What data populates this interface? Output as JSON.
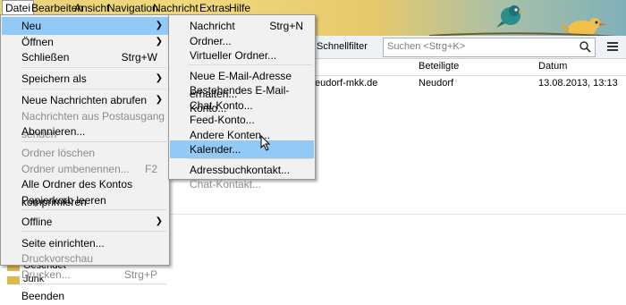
{
  "menubar": [
    "Datei",
    "Bearbeiten",
    "Ansicht",
    "Navigation",
    "Nachricht",
    "Extras",
    "Hilfe"
  ],
  "toolbar": {
    "quickfilter_label": "Schnellfilter",
    "search_placeholder": "Suchen <Strg+K>"
  },
  "list_header": {
    "col_beteiligte": "Beteiligte",
    "col_datum": "Datum"
  },
  "list_row": {
    "subject_fragment": "eudorf-mkk.de",
    "beteiligte": "Neudorf",
    "datum": "13.08.2013, 13:13"
  },
  "folders": [
    "Gesendet",
    "Junk"
  ],
  "file_menu": [
    {
      "label": "Neu",
      "submenu": true,
      "highlighted": true
    },
    {
      "label": "Öffnen",
      "submenu": true
    },
    {
      "label": "Schließen",
      "shortcut": "Strg+W"
    },
    {
      "sep": true
    },
    {
      "label": "Speichern als",
      "submenu": true
    },
    {
      "sep": true
    },
    {
      "label": "Neue Nachrichten abrufen",
      "submenu": true
    },
    {
      "label": "Nachrichten aus Postausgang senden",
      "disabled": true
    },
    {
      "label": "Abonnieren..."
    },
    {
      "sep": true
    },
    {
      "label": "Ordner löschen",
      "disabled": true
    },
    {
      "label": "Ordner umbenennen...",
      "disabled": true,
      "shortcut": "F2"
    },
    {
      "label": "Alle Ordner des Kontos komprimieren"
    },
    {
      "label": "Papierkorb leeren"
    },
    {
      "sep": true
    },
    {
      "label": "Offline",
      "submenu": true
    },
    {
      "sep": true
    },
    {
      "label": "Seite einrichten..."
    },
    {
      "label": "Druckvorschau",
      "disabled": true
    },
    {
      "label": "Drucken...",
      "disabled": true,
      "shortcut": "Strg+P"
    },
    {
      "sep": true
    },
    {
      "label": "Beenden"
    }
  ],
  "new_menu": [
    {
      "label": "Nachricht",
      "shortcut": "Strg+N"
    },
    {
      "label": "Ordner..."
    },
    {
      "label": "Virtueller Ordner..."
    },
    {
      "sep": true
    },
    {
      "label": "Neue E-Mail-Adresse erhalten..."
    },
    {
      "label": "Bestehendes E-Mail-Konto..."
    },
    {
      "label": "Chat-Konto..."
    },
    {
      "label": "Feed-Konto..."
    },
    {
      "label": "Andere Konten..."
    },
    {
      "label": "Kalender...",
      "highlighted": true
    },
    {
      "sep": true
    },
    {
      "label": "Adressbuchkontakt..."
    },
    {
      "label": "Chat-Kontakt...",
      "disabled": true
    }
  ]
}
